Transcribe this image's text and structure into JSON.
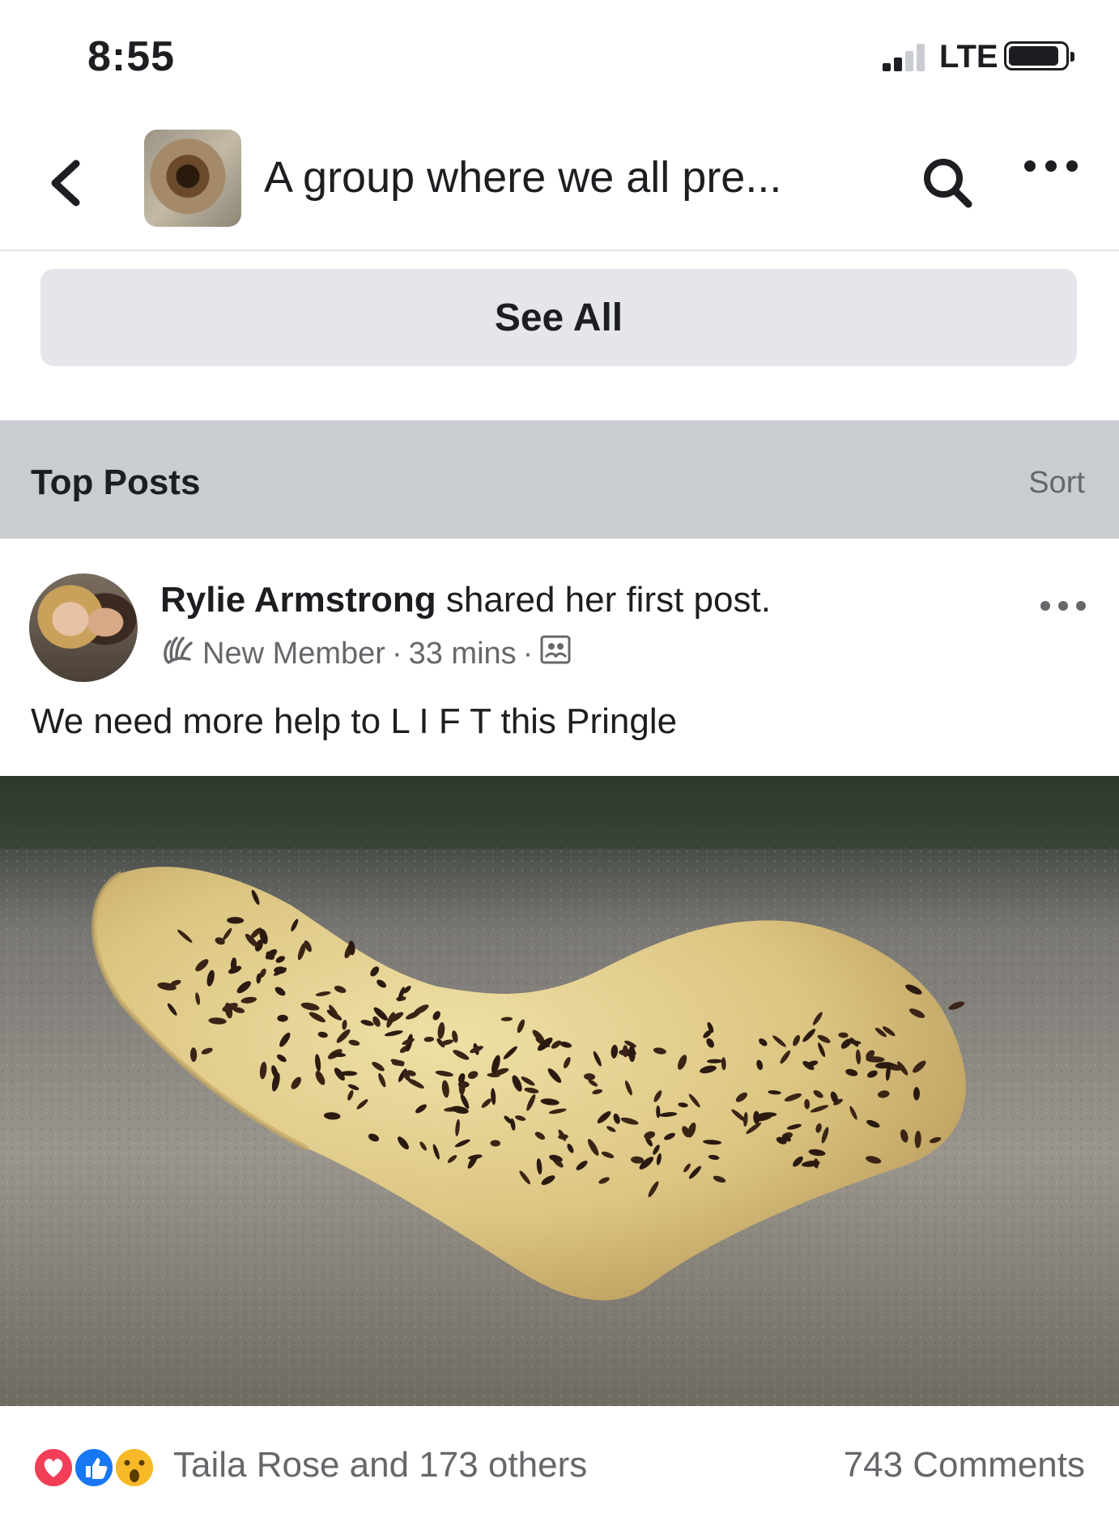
{
  "status_bar": {
    "time": "8:55",
    "carrier": "LTE",
    "battery_level": 0.9
  },
  "nav": {
    "back_icon": "chevron-left-icon",
    "group_title": "A group where we all pre...",
    "search_icon": "search-icon",
    "more_icon": "more-horizontal-icon"
  },
  "see_all": {
    "label": "See All"
  },
  "section": {
    "title": "Top Posts",
    "sort_label": "Sort"
  },
  "post": {
    "author": "Rylie Armstrong",
    "action": " shared her first post.",
    "badge": "New Member",
    "separator": "·",
    "time": "33 mins",
    "privacy_icon": "group-icon",
    "text": "We need more help to L I F T this Pringle"
  },
  "reactions": {
    "icons": [
      "love-icon",
      "like-icon",
      "wow-icon"
    ],
    "summary": "Taila Rose and 173 others",
    "comments": "743 Comments"
  },
  "colors": {
    "section_bg": "#c9ccd1",
    "button_bg": "#e4e6eb",
    "secondary_text": "#65676b",
    "like_blue": "#1877f2",
    "love_red": "#f33e58",
    "wow_yellow": "#f7b928"
  }
}
